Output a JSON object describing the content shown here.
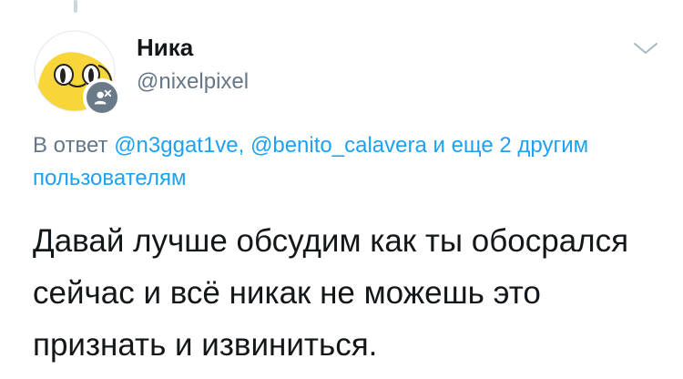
{
  "author": {
    "display_name": "Ника",
    "username": "@nixelpixel"
  },
  "reply_context": {
    "prefix": "В ответ ",
    "mention_1": "@n3ggat1ve",
    "separator": ", ",
    "mention_2": "@benito_calavera",
    "others": " и еще 2 другим пользователям"
  },
  "tweet": {
    "text": "Давай лучше обсудим как ты обосрался сейчас и всё никак не можешь это признать и извиниться."
  },
  "icons": {
    "avatar": "jake-the-dog-avatar-icon",
    "badge": "muted-user-icon",
    "menu": "chevron-down-icon"
  },
  "colors": {
    "link": "#1da1f2",
    "secondary_text": "#657786",
    "primary_text": "#14171a",
    "avatar_yellow": "#f8d63a",
    "badge_gray": "#6b7a88"
  }
}
